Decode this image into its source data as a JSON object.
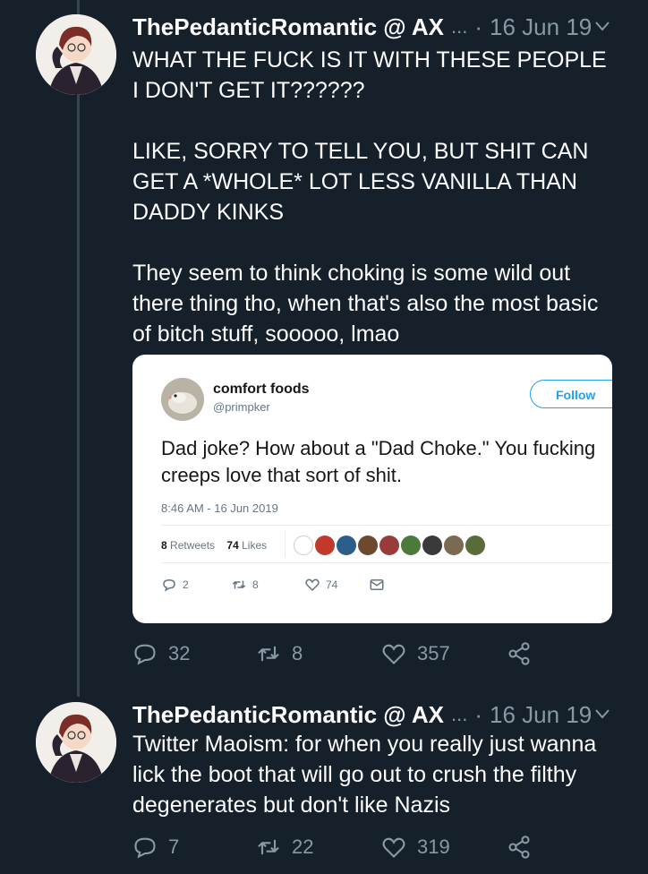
{
  "tweets": [
    {
      "display_name": "ThePedanticRomantic @ AX",
      "ellipsis": "...",
      "separator": "·",
      "date": "16 Jun 19",
      "paragraphs": [
        "WHAT THE FUCK IS IT WITH THESE PEOPLE I DON'T GET IT??????",
        "LIKE, SORRY TO TELL YOU, BUT SHIT CAN GET A *WHOLE* LOT LESS VANILLA THAN DADDY KINKS",
        "They seem to think choking is some wild out there thing tho, when that's also the most basic of bitch stuff, sooooo, lmao"
      ],
      "replies": "32",
      "retweets": "8",
      "likes": "357"
    },
    {
      "display_name": "ThePedanticRomantic @ AX",
      "ellipsis": "...",
      "separator": "·",
      "date": "16 Jun 19",
      "paragraphs": [
        "Twitter Maoism: for when you really just wanna lick the boot that will go out to crush the filthy degenerates but don't like Nazis"
      ],
      "replies": "7",
      "retweets": "22",
      "likes": "319"
    }
  ],
  "embedded_tweet": {
    "name": "comfort foods",
    "handle": "@primpker",
    "follow_label": "Follow",
    "text": "Dad joke? How about a \"Dad Choke.\" You fucking creeps love that sort of shit.",
    "timestamp": "8:46 AM - 16 Jun 2019",
    "retweets_count": "8",
    "retweets_label": "Retweets",
    "likes_count": "74",
    "likes_label": "Likes",
    "reply_count": "2",
    "retweet_count": "8",
    "like_count": "74"
  },
  "colors": {
    "background": "#15202b",
    "secondary_text": "#8899a6",
    "accent": "#1da1f2"
  },
  "icons": [
    "avatar",
    "chevron-down-icon",
    "reply-icon",
    "retweet-icon",
    "like-icon",
    "share-icon",
    "mail-icon"
  ]
}
